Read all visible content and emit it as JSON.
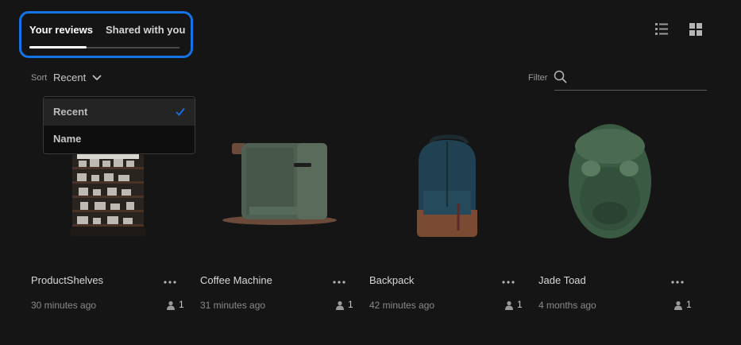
{
  "tabs": [
    {
      "label": "Your reviews",
      "active": true
    },
    {
      "label": "Shared with you",
      "active": false
    }
  ],
  "toolbar": {
    "list_view_icon": "list-view-icon",
    "grid_view_icon": "grid-view-icon"
  },
  "sort": {
    "label": "Sort",
    "value": "Recent",
    "options": [
      {
        "label": "Recent",
        "selected": true
      },
      {
        "label": "Name",
        "selected": false
      }
    ]
  },
  "filter": {
    "label": "Filter",
    "placeholder": "",
    "value": ""
  },
  "cards": [
    {
      "title": "ProductShelves",
      "time": "30 minutes ago",
      "shared_count": "1"
    },
    {
      "title": "Coffee Machine",
      "time": "31 minutes ago",
      "shared_count": "1"
    },
    {
      "title": "Backpack",
      "time": "42 minutes ago",
      "shared_count": "1"
    },
    {
      "title": "Jade Toad",
      "time": "4 months ago",
      "shared_count": "1"
    }
  ],
  "colors": {
    "background": "#151515",
    "focus_ring": "#1473e6",
    "text_primary": "#d8d8d8",
    "text_secondary": "#8a8a8a"
  }
}
